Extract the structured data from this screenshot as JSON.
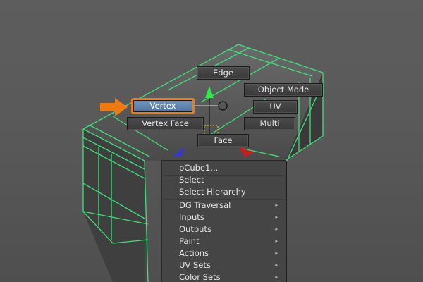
{
  "marking_menu": {
    "edge": "Edge",
    "object_mode": "Object Mode",
    "vertex": "Vertex",
    "uv": "UV",
    "vertex_face": "Vertex Face",
    "multi": "Multi",
    "face": "Face",
    "selected_item": "Vertex"
  },
  "context_menu": {
    "title": "pCube1...",
    "select": "Select",
    "select_hierarchy": "Select Hierarchy",
    "submenus": [
      "DG Traversal",
      "Inputs",
      "Outputs",
      "Paint",
      "Actions",
      "UV Sets",
      "Color Sets"
    ]
  },
  "colors": {
    "viewport_bg": "#5a5a5a",
    "mesh_wire": "#3ee07a",
    "highlight": "#f07a12",
    "selected_button": "#6a8fbf"
  },
  "icons": {
    "pointer_arrow": "orange-arrow-icon",
    "submenu_arrow": "chevron-right-icon"
  }
}
